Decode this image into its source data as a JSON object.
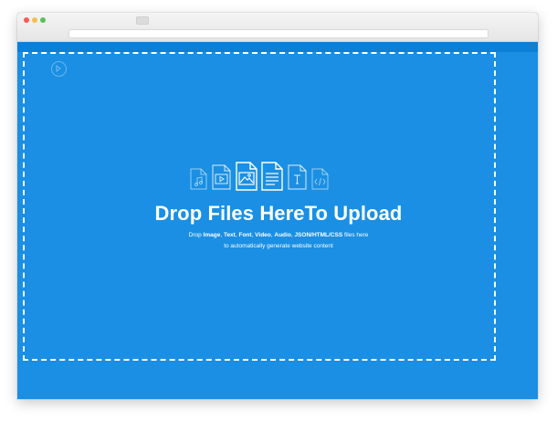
{
  "colors": {
    "accent": "#1a8fe3",
    "app_bar": "#0c7fd6",
    "text": "#ffffff"
  },
  "icons": [
    "audio-file-icon",
    "video-file-icon",
    "image-file-icon",
    "text-file-icon",
    "font-file-icon",
    "code-file-icon"
  ],
  "drop_zone": {
    "headline": "Drop Files HereTo Upload",
    "line1": {
      "prefix": "Drop ",
      "types": [
        {
          "label": "Image",
          "sep": ", "
        },
        {
          "label": "Text",
          "sep": ", "
        },
        {
          "label": "Font",
          "sep": ", "
        },
        {
          "label": "Video",
          "sep": ", "
        },
        {
          "label": "Audio",
          "sep": ", "
        },
        {
          "label": "JSON/HTML/CSS",
          "sep": ""
        }
      ],
      "suffix": " files here"
    },
    "line2": "to automatically generate website content"
  }
}
